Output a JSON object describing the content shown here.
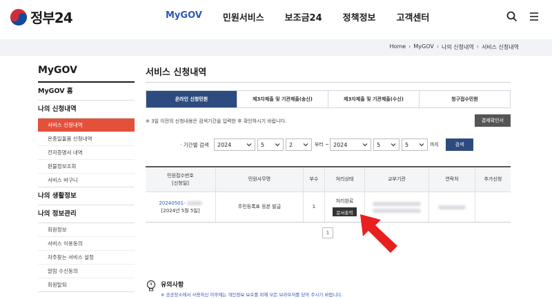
{
  "header": {
    "logo_text": "정부24",
    "nav": [
      "MyGOV",
      "민원서비스",
      "보조금24",
      "정책정보",
      "고객센터"
    ],
    "active_nav": "MyGOV"
  },
  "breadcrumb": [
    "Home",
    "MyGOV",
    "나의 신청내역",
    "서비스 신청내역"
  ],
  "sidebar": {
    "title": "MyGOV",
    "home": "MyGOV 홈",
    "group1": "나의 신청내역",
    "group1_items": [
      "서비스 신청내역",
      "온종일돌봄 신청내역",
      "전자증명서 내역",
      "환불정보조회",
      "서비스 바구니"
    ],
    "group2": "나의 생활정보",
    "group3": "나의 정보관리",
    "group3_items": [
      "회원정보",
      "서비스 이용동의",
      "자주찾는 서비스 설정",
      "알림 수신동의",
      "회원탈퇴"
    ]
  },
  "main": {
    "title": "서비스 신청내역",
    "tabs": [
      "온라인 신청민원",
      "제3자제출 및 기관제출(송신)",
      "제3자제출 및 기관제출(수신)",
      "청구접수민원"
    ],
    "notice": "※ 3일 이전의 신청내용은 검색기간을 입력한 후 확인하시기 바랍니다.",
    "payment_button": "결제확인서",
    "filter": {
      "label": "· 기간별 검색",
      "from_year": "2024",
      "from_month": "5",
      "from_day": "2",
      "from_text": "부터 ~",
      "to_year": "2024",
      "to_month": "5",
      "to_day": "5",
      "to_text": "까지",
      "search_button": "검색"
    },
    "table": {
      "headers": [
        "민원접수번호\n[신청일]",
        "민원사무명",
        "부수",
        "처리상태",
        "교부기관",
        "연락처",
        "추가신청"
      ],
      "row": {
        "receipt_no": "20240501-",
        "date": "[2024년 5월 5일]",
        "name": "주민등록표 등본 발급",
        "count": "1",
        "status": "처리완료",
        "print_button": "문서출력"
      }
    },
    "page": "1"
  },
  "bottom_notice": {
    "title": "유의사항",
    "text": "※ 공공장소에서 사용하신 이후에는 개인정보 보호를 위해 모든 브라우저를 닫아 주시기 바랍니다."
  },
  "colors": {
    "accent": "#2e4b80",
    "active_side": "#e4513b",
    "link": "#2c56b5",
    "arrow": "#e8201f"
  }
}
